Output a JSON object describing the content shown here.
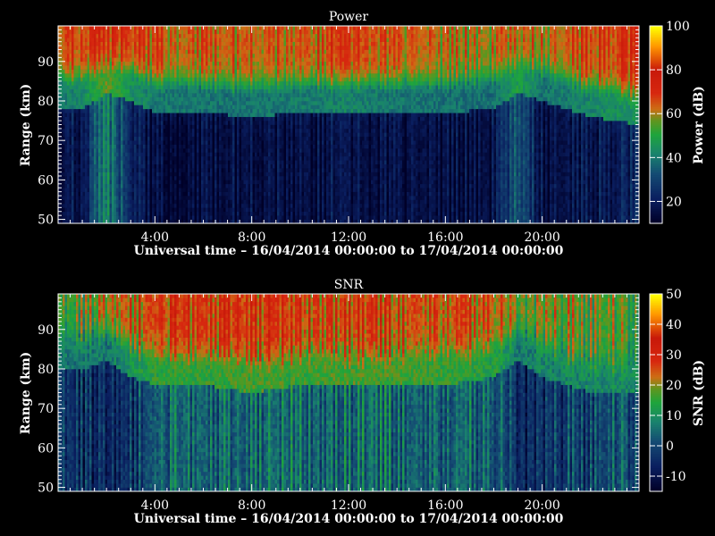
{
  "chart_data": [
    {
      "type": "heatmap",
      "title": "Power",
      "xlabel": "Universal time – 16/04/2014 00:00:00 to 17/04/2014 00:00:00",
      "ylabel": "Range (km)",
      "xlim": [
        0,
        24
      ],
      "ylim": [
        49,
        99
      ],
      "xticks": [
        "4:00",
        "8:00",
        "12:00",
        "16:00",
        "20:00"
      ],
      "yticks": [
        "50",
        "60",
        "70",
        "80",
        "90"
      ],
      "colorbar": {
        "label": "Power (dB)",
        "range": [
          10,
          100
        ],
        "ticks": [
          "20",
          "40",
          "60",
          "80",
          "100"
        ]
      },
      "profile": {
        "hours": [
          0,
          1,
          2,
          3,
          4,
          6,
          8,
          10,
          12,
          14,
          16,
          18,
          19,
          20,
          22,
          24
        ],
        "top_level": [
          65,
          68,
          70,
          68,
          66,
          64,
          63,
          65,
          68,
          64,
          62,
          60,
          63,
          62,
          67,
          70
        ],
        "transition_km": [
          84,
          84,
          88,
          86,
          83,
          83,
          82,
          83,
          83,
          83,
          83,
          84,
          88,
          86,
          82,
          80
        ],
        "bottom_level": [
          16,
          18,
          42,
          22,
          14,
          14,
          15,
          16,
          16,
          15,
          15,
          16,
          34,
          16,
          18,
          22
        ]
      }
    },
    {
      "type": "heatmap",
      "title": "SNR",
      "xlabel": "Universal time – 16/04/2014 00:00:00 to 17/04/2014 00:00:00",
      "ylabel": "Range (km)",
      "xlim": [
        0,
        24
      ],
      "ylim": [
        49,
        99
      ],
      "xticks": [
        "4:00",
        "8:00",
        "12:00",
        "16:00",
        "20:00"
      ],
      "yticks": [
        "50",
        "60",
        "70",
        "80",
        "90"
      ],
      "colorbar": {
        "label": "SNR (dB)",
        "range": [
          -15,
          50
        ],
        "ticks": [
          "-10",
          "0",
          "10",
          "20",
          "30",
          "40",
          "50"
        ]
      },
      "profile": {
        "hours": [
          0,
          1,
          2,
          3,
          4,
          6,
          8,
          10,
          12,
          14,
          16,
          18,
          19,
          20,
          22,
          24
        ],
        "top_level": [
          15,
          17,
          20,
          24,
          26,
          27,
          28,
          27,
          28,
          27,
          26,
          24,
          18,
          20,
          18,
          16
        ],
        "transition_km": [
          86,
          86,
          88,
          84,
          82,
          82,
          80,
          82,
          82,
          82,
          82,
          84,
          88,
          84,
          80,
          80
        ],
        "bottom_level": [
          -2,
          -4,
          -8,
          -4,
          3,
          3,
          4,
          5,
          5,
          5,
          4,
          3,
          -5,
          -3,
          0,
          2
        ]
      }
    }
  ]
}
